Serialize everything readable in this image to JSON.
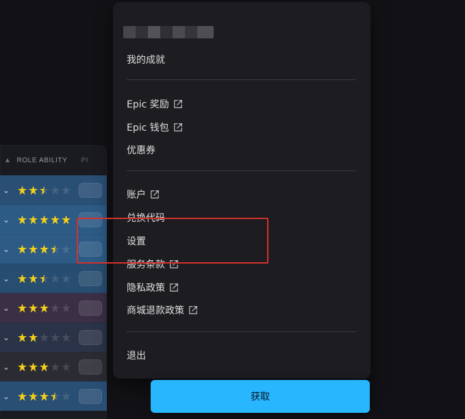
{
  "background_list": {
    "header": {
      "left_marker": "▲",
      "role_ability": "ROLE ABILITY",
      "pi": "PI"
    },
    "rows": [
      {
        "rating": 2.5
      },
      {
        "rating": 5.0
      },
      {
        "rating": 3.5
      },
      {
        "rating": 2.5
      },
      {
        "rating": 3.0
      },
      {
        "rating": 2.0
      },
      {
        "rating": 3.0
      },
      {
        "rating": 3.5
      }
    ]
  },
  "menu": {
    "username": "",
    "items": [
      {
        "label": "我的成就",
        "external": false
      },
      {
        "label": "Epic 奖励",
        "external": true
      },
      {
        "label": "Epic 钱包",
        "external": true
      },
      {
        "label": "优惠券",
        "external": false
      },
      {
        "label": "账户",
        "external": true
      },
      {
        "label": "兑换代码",
        "external": false
      },
      {
        "label": "设置",
        "external": false
      },
      {
        "label": "服务条款",
        "external": true
      },
      {
        "label": "隐私政策",
        "external": true
      },
      {
        "label": "商城退款政策",
        "external": true
      },
      {
        "label": "退出",
        "external": false
      }
    ]
  },
  "footer": {
    "get_button_label": "获取"
  },
  "colors": {
    "menu_bg": "#1c1c21",
    "get_button_bg": "#28b6ff",
    "highlight_border": "#d6322b",
    "star": "#f2cf1a"
  },
  "icons": {
    "external_link": "external-link-icon",
    "chevron": "chevron-down-icon",
    "star": "star-icon"
  }
}
